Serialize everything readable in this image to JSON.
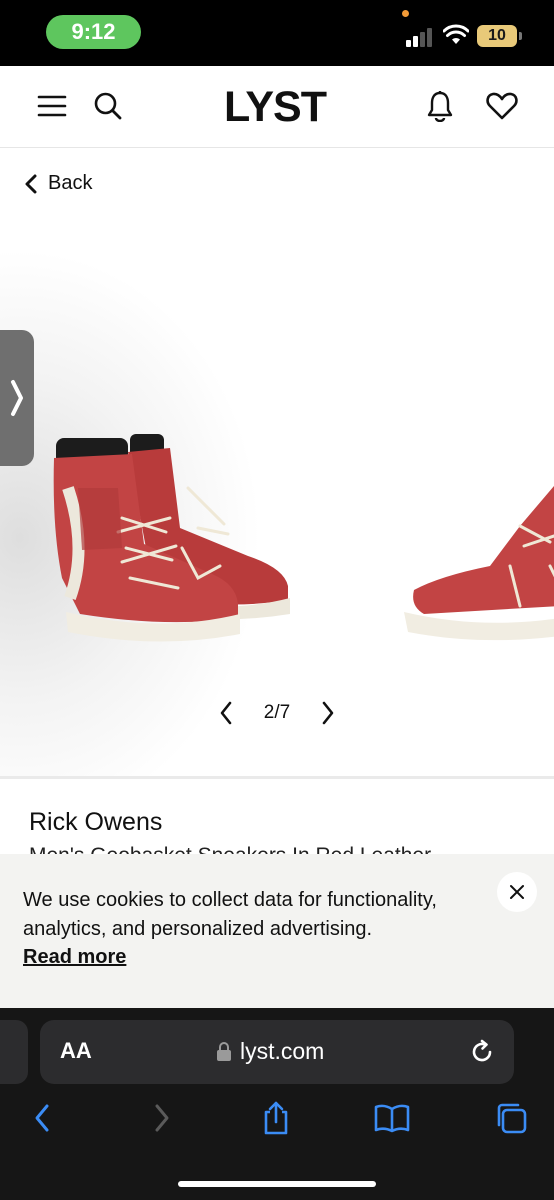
{
  "status_bar": {
    "time": "9:12",
    "battery": "10",
    "time_pill_color": "#5ec65e",
    "battery_color": "#e8c979"
  },
  "header": {
    "logo": "LYST",
    "icons": [
      "menu-icon",
      "search-icon",
      "bell-icon",
      "heart-icon"
    ]
  },
  "gallery": {
    "back_label": "Back",
    "current": "2/7",
    "images": [
      "red high-top sneakers, side view",
      "red high-top sneaker, partial next image"
    ]
  },
  "product": {
    "brand": "Rick Owens",
    "title": "Men's Geobasket Sneakers In Red Leather"
  },
  "cookie_banner": {
    "text": "We use cookies to collect data for functionality, analytics, and personalized advertising.",
    "read_more": "Read more"
  },
  "browser": {
    "aa_label": "AA",
    "url": "lyst.com",
    "toolbar_icons": [
      "back-icon",
      "forward-icon",
      "share-icon",
      "bookmarks-icon",
      "tabs-icon"
    ],
    "accent": "#3b8cf5"
  }
}
